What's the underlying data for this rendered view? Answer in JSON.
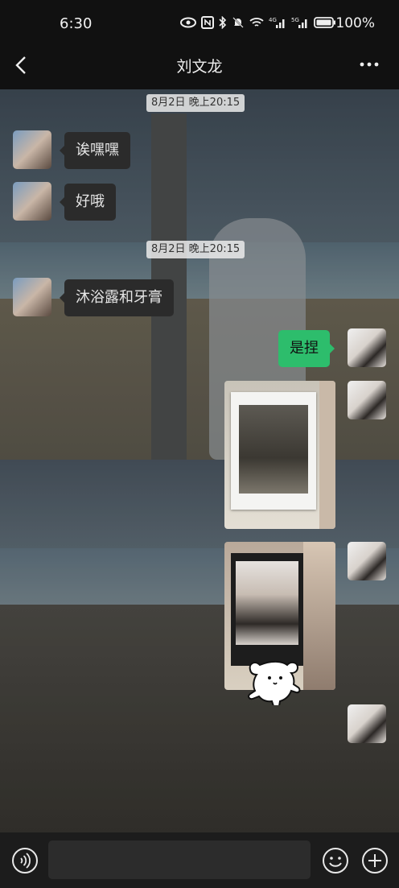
{
  "status_bar": {
    "time": "6:30",
    "battery": "100%",
    "network_left": "4G",
    "network_right": "5G"
  },
  "header": {
    "title": "刘文龙"
  },
  "messages": {
    "ts1": "8月2日 晚上20:15",
    "m1": "诶嘿嘿",
    "m2": "好哦",
    "ts2": "8月2日 晚上20:15",
    "m3": "沐浴露和牙膏",
    "m4": "是捏"
  },
  "colors": {
    "accent": "#2dbd6c",
    "incoming_bubble": "#2b2b2b",
    "background": "#111111"
  },
  "icons": {
    "back": "chevron-left-icon",
    "more": "more-icon",
    "voice": "voice-icon",
    "emoji": "emoji-icon",
    "plus": "plus-icon"
  }
}
